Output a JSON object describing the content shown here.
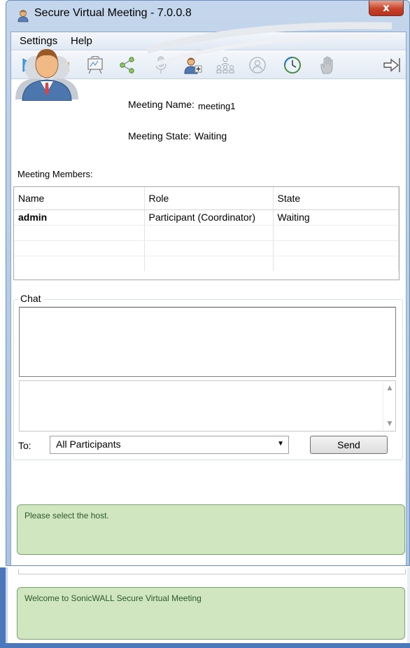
{
  "window": {
    "title": "Secure Virtual Meeting - 7.0.0.8",
    "close_label": "x"
  },
  "menu": {
    "items": [
      "Settings",
      "Help"
    ]
  },
  "toolbar": {
    "icons": [
      "play-icon",
      "equalizer-icon",
      "whiteboard-icon",
      "share-icon",
      "microphone-icon",
      "add-user-icon",
      "org-chart-icon",
      "user-circle-icon",
      "clock-icon",
      "raise-hand-icon",
      "exit-icon"
    ]
  },
  "meeting": {
    "name_label": "Meeting Name:",
    "name_value": "meeting1",
    "state_label": "Meeting State:",
    "state_value": "Waiting"
  },
  "members": {
    "section_label": "Meeting Members:",
    "columns": [
      "Name",
      "Role",
      "State"
    ],
    "rows": [
      {
        "name": "admin",
        "role": "Participant (Coordinator)",
        "state": "Waiting"
      }
    ]
  },
  "chat": {
    "legend": "Chat",
    "to_label": "To:",
    "recipient": "All Participants",
    "send_label": "Send"
  },
  "status": {
    "main": "Please select the host.",
    "background": "Welcome to SonicWALL Secure Virtual Meeting"
  },
  "colors": {
    "status_bg": "#cfe6c0",
    "titlebar": "#b9cfe8",
    "close": "#c7422a"
  }
}
